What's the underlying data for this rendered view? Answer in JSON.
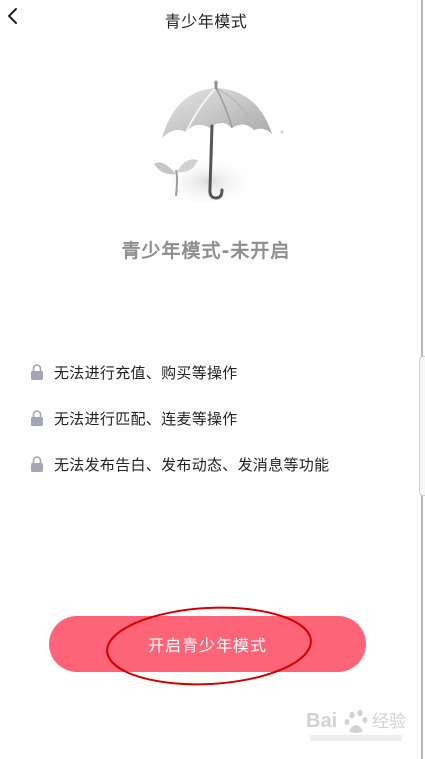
{
  "header": {
    "back_icon": "chevron-left-icon",
    "title": "青少年模式"
  },
  "illustration": {
    "icon": "umbrella-sprout-icon"
  },
  "status_title": "青少年模式-未开启",
  "restrictions": [
    {
      "icon": "lock-icon",
      "text": "无法进行充值、购买等操作"
    },
    {
      "icon": "lock-icon",
      "text": "无法进行匹配、连麦等操作"
    },
    {
      "icon": "lock-icon",
      "text": "无法发布告白、发布动态、发消息等功能"
    }
  ],
  "enable_button": {
    "label": "开启青少年模式",
    "color": "#fe6478"
  },
  "annotation": {
    "color": "#d40000"
  },
  "watermark": {
    "icon": "baidu-jingyan-logo",
    "text": "Bai 经验"
  }
}
